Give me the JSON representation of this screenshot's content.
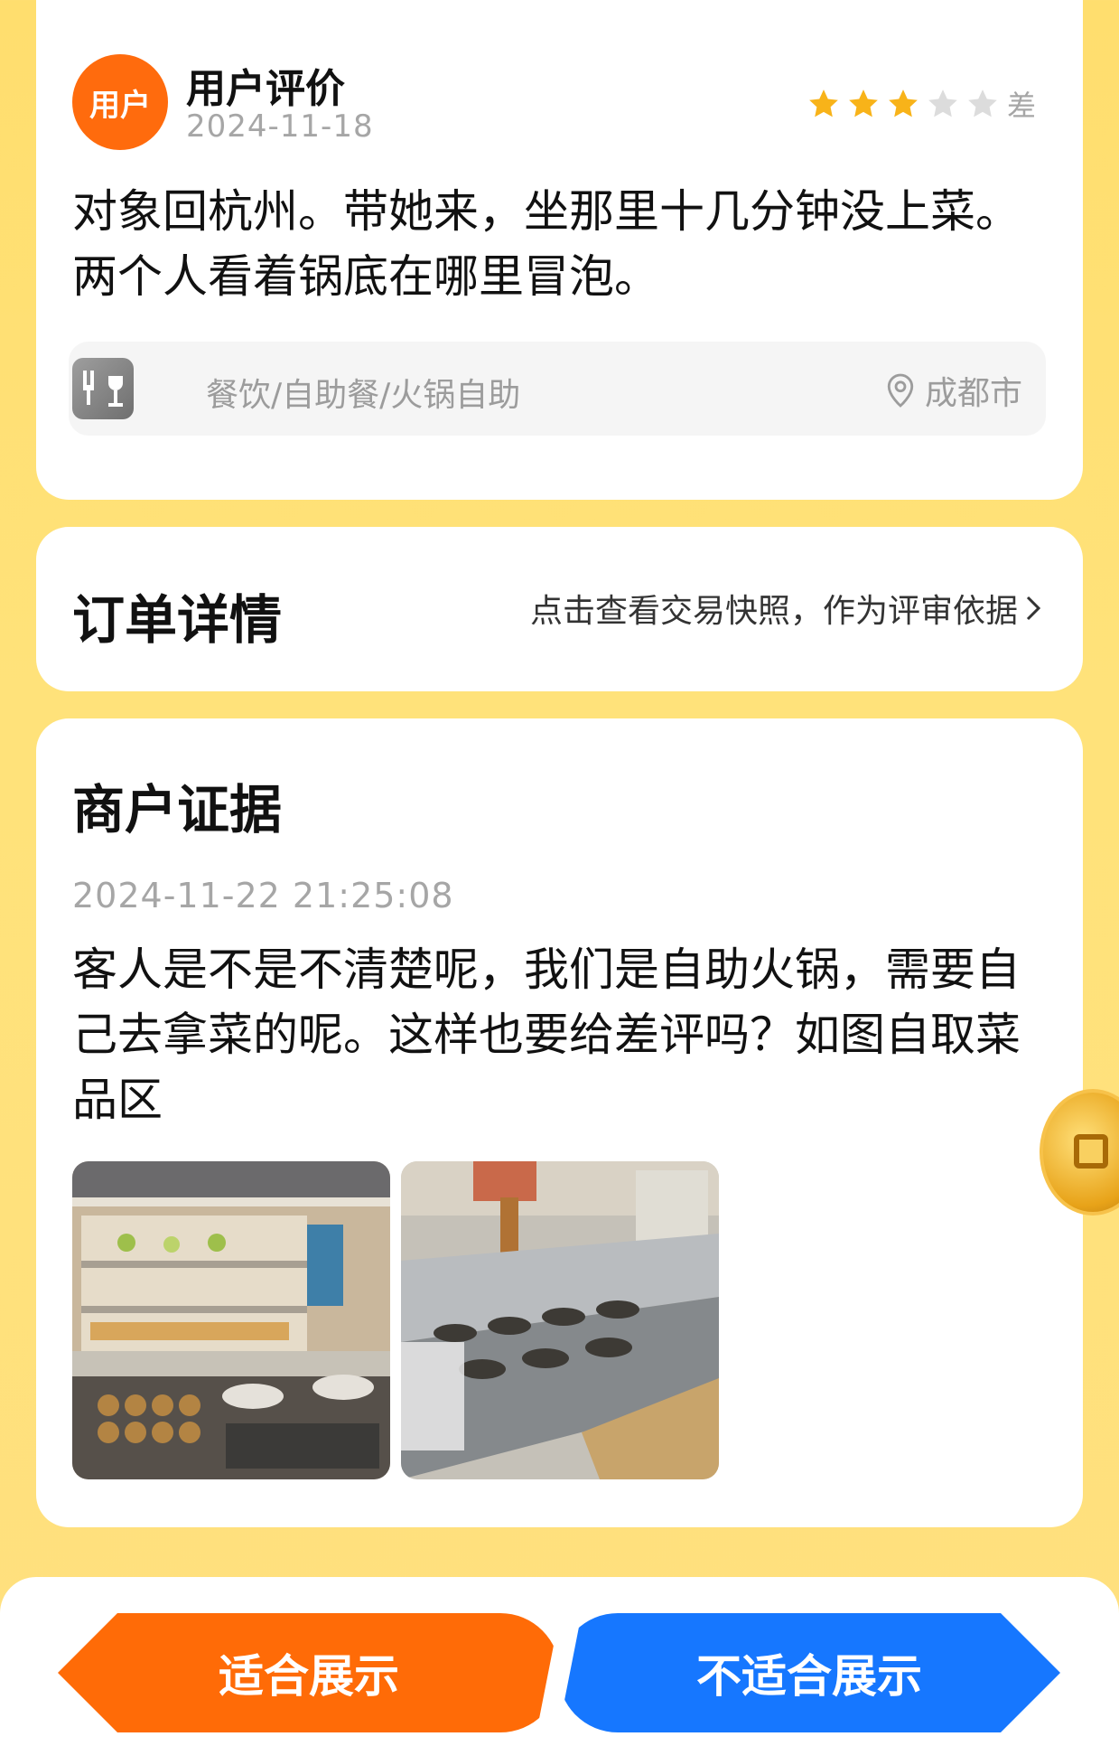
{
  "review": {
    "avatar_text": "用户",
    "user_name": "用户评价",
    "date": "2024-11-18",
    "rating": 3,
    "rating_max": 5,
    "rating_label": "差",
    "text": "对象回杭州。带她来，坐那里十几分钟没上菜。两个人看着锅底在哪里冒泡。",
    "category": "餐饮/自助餐/火锅自助",
    "location": "成都市"
  },
  "order": {
    "title": "订单详情",
    "link_text": "点击查看交易快照，作为评审依据"
  },
  "merchant": {
    "title": "商户证据",
    "timestamp": "2024-11-22 21:25:08",
    "text": "客人是不是不清楚呢，我们是自助火锅，需要自己去拿菜的呢。这样也要给差评吗？如图自取菜品区",
    "photos": [
      "buffet-shelf-photo",
      "buffet-counter-photo"
    ]
  },
  "actions": {
    "suitable": "适合展示",
    "unsuitable": "不适合展示"
  },
  "colors": {
    "background": "#ffde6e",
    "primary_orange": "#ff6b07",
    "primary_blue": "#1677ff",
    "star_active": "#f8b319",
    "star_inactive": "#dcdcdc"
  }
}
